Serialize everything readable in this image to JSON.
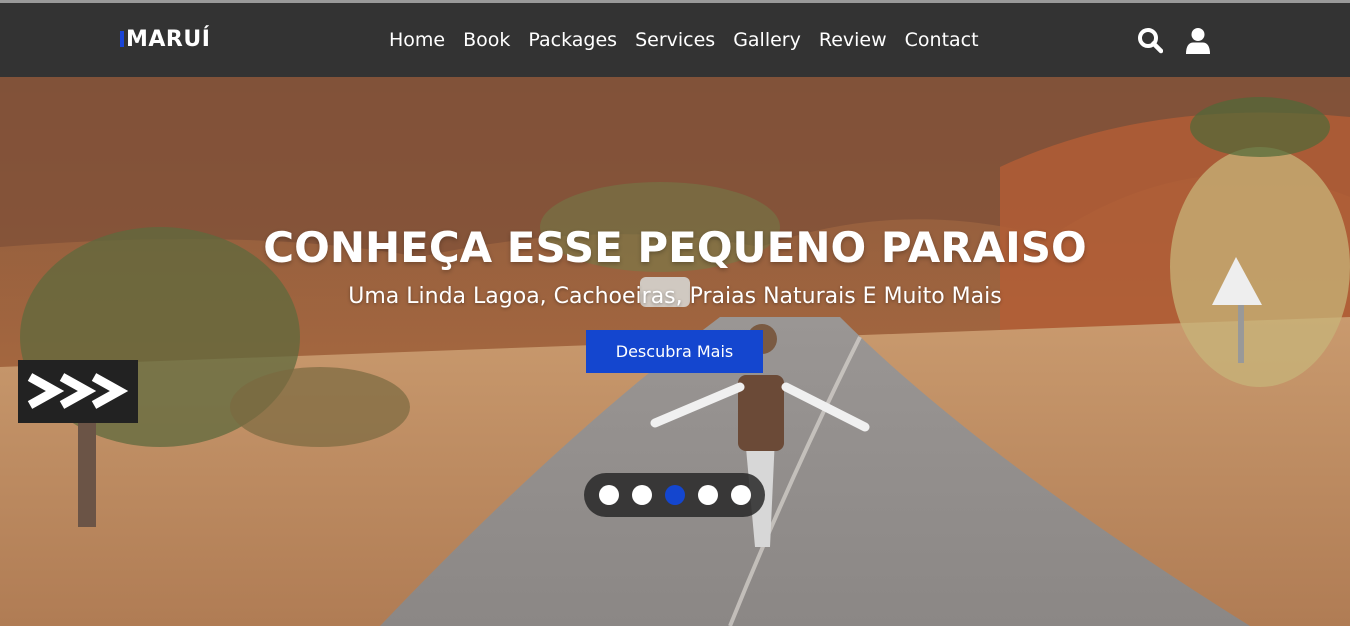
{
  "brand": {
    "name": "MARUÍ",
    "accent_color": "#1a44d6"
  },
  "nav": {
    "items": [
      "Home",
      "Book",
      "Packages",
      "Services",
      "Gallery",
      "Review",
      "Contact"
    ]
  },
  "header_icons": [
    "search-icon",
    "user-icon"
  ],
  "hero": {
    "title": "CONHEÇA ESSE PEQUENO PARAISO",
    "subtitle": "Uma Linda Lagoa, Cachoeiras, Praias Naturais E Muito Mais",
    "cta_label": "Descubra Mais",
    "slider": {
      "count": 5,
      "active_index": 2
    }
  },
  "colors": {
    "navbar": "#333333",
    "button": "#1446cf",
    "active_dot": "#1446cf"
  }
}
